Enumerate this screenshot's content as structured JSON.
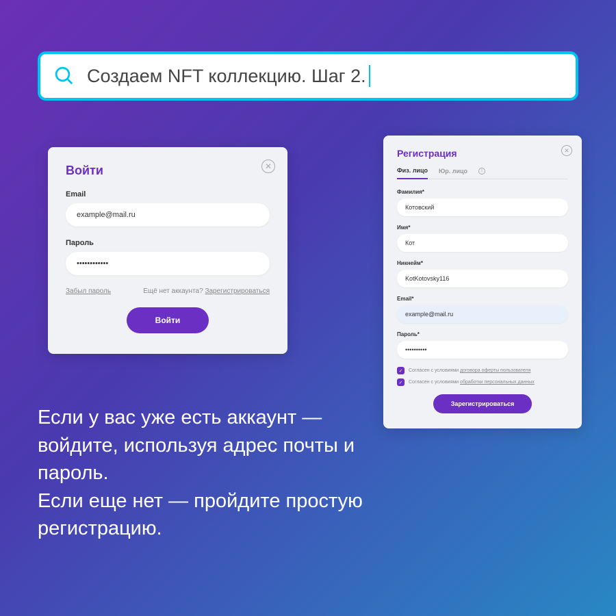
{
  "search": {
    "text": "Создаем NFT коллекцию. Шаг 2."
  },
  "login": {
    "title": "Войти",
    "email_label": "Email",
    "email_value": "example@mail.ru",
    "password_label": "Пароль",
    "password_value": "••••••••••••",
    "forgot": "Забыл пароль",
    "no_account": "Ещё нет аккаунта?",
    "register_link": "Зарегистрироваться",
    "submit": "Войти"
  },
  "register": {
    "title": "Регистрация",
    "tab1": "Физ. лицо",
    "tab2": "Юр. лицо",
    "surname_label": "Фамилия*",
    "surname_value": "Котовский",
    "name_label": "Имя*",
    "name_value": "Кот",
    "nickname_label": "Никнейм*",
    "nickname_value": "KotKotovsky116",
    "email_label": "Email*",
    "email_value": "example@mail.ru",
    "password_label": "Пароль*",
    "password_value": "••••••••••",
    "agree1_text": "Согласен с условиями ",
    "agree1_link": "договора оферты пользователя",
    "agree2_text": "Согласен с условиями ",
    "agree2_link": "обработки персональных данных",
    "submit": "Зарегистрироваться"
  },
  "main_text": {
    "line1": "Если у вас уже есть аккаунт —  войдите, используя адрес почты и пароль.",
    "line2": "Если еще нет — пройдите простую регистрацию."
  }
}
